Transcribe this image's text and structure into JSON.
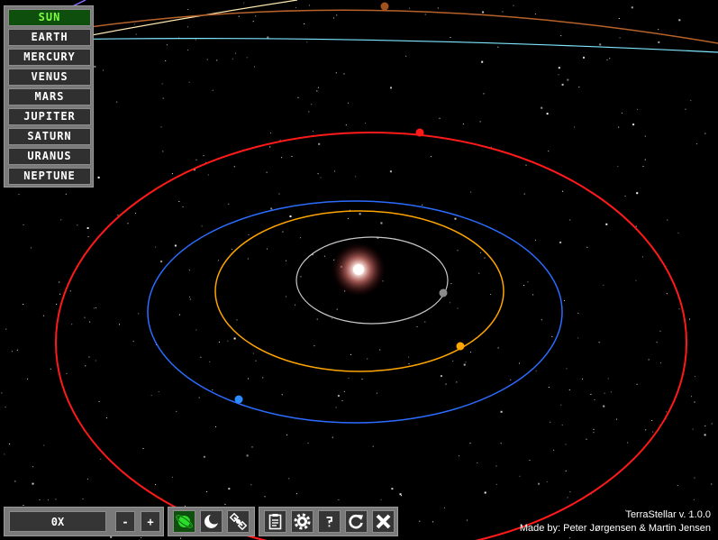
{
  "planets": [
    {
      "label": "SUN",
      "active": true
    },
    {
      "label": "EARTH"
    },
    {
      "label": "MERCURY"
    },
    {
      "label": "VENUS"
    },
    {
      "label": "MARS"
    },
    {
      "label": "JUPITER"
    },
    {
      "label": "SATURN"
    },
    {
      "label": "URANUS"
    },
    {
      "label": "NEPTUNE"
    }
  ],
  "speed": {
    "value": "0X",
    "minus_label": "-",
    "plus_label": "+"
  },
  "view_buttons": [
    "planet-icon",
    "moon-icon",
    "satellite-icon"
  ],
  "tool_buttons": [
    "clipboard-icon",
    "gear-icon",
    "help-icon",
    "reset-icon",
    "close-icon"
  ],
  "credits": {
    "version": "TerraStellar v. 1.0.0",
    "authors": "Made by: Peter Jørgensen & Martin Jensen"
  },
  "colors": {
    "active_button_bg": "#0e4f0e",
    "active_text": "#7dff3f",
    "mercury_orbit": "#c8c8c8",
    "venus_orbit": "#ffa500",
    "earth_orbit": "#2b6cff",
    "mars_orbit": "#ff1a1a",
    "jupiter_orbit": "#b8622a",
    "saturn_orbit": "#ffe9b0",
    "uranus_orbit": "#7fe6ff",
    "neptune_orbit": "#8a6cff"
  }
}
